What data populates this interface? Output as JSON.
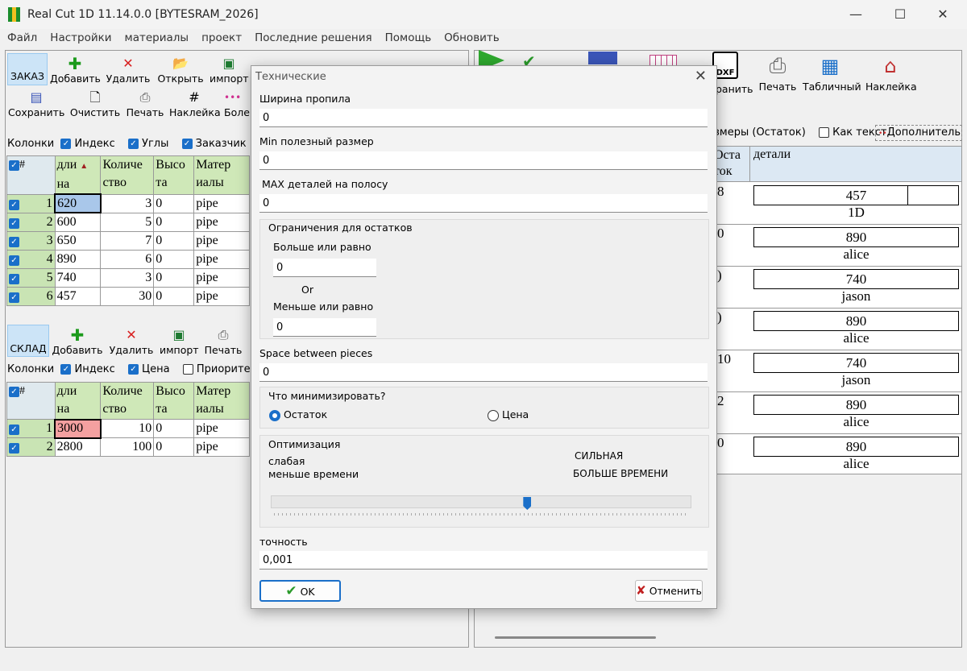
{
  "window": {
    "title": "Real Cut 1D 11.14.0.0 [BYTESRAM_2026]",
    "minimize": "—",
    "maximize": "☐",
    "close": "✕"
  },
  "menu": [
    "Файл",
    "Настройки",
    "материалы",
    "проект",
    "Последние решения",
    "Помощь",
    "Обновить"
  ],
  "order_toolbar": {
    "tab": "ЗАКАЗ",
    "add": "Добавить",
    "delete": "Удалить",
    "open": "Открыть",
    "import": "импорт",
    "save": "Сохранить",
    "clear": "Очистить",
    "print": "Печать",
    "label": "Наклейка",
    "more": "Боле"
  },
  "order_columns": {
    "label": "Колонки",
    "index": "Индекс",
    "angles": "Углы",
    "customer": "Заказчик"
  },
  "order_table": {
    "headers": [
      [
        "#",
        ""
      ],
      [
        "дли",
        "на"
      ],
      [
        "Количе",
        "ство"
      ],
      [
        "Высо",
        "та"
      ],
      [
        "Матер",
        "иалы"
      ]
    ],
    "rows": [
      {
        "n": "1",
        "length": "620",
        "qty": "3",
        "height": "0",
        "mat": "pipe"
      },
      {
        "n": "2",
        "length": "600",
        "qty": "5",
        "height": "0",
        "mat": "pipe"
      },
      {
        "n": "3",
        "length": "650",
        "qty": "7",
        "height": "0",
        "mat": "pipe"
      },
      {
        "n": "4",
        "length": "890",
        "qty": "6",
        "height": "0",
        "mat": "pipe"
      },
      {
        "n": "5",
        "length": "740",
        "qty": "3",
        "height": "0",
        "mat": "pipe"
      },
      {
        "n": "6",
        "length": "457",
        "qty": "30",
        "height": "0",
        "mat": "pipe"
      }
    ]
  },
  "stock_toolbar": {
    "tab": "СКЛАД",
    "add": "Добавить",
    "delete": "Удалить",
    "import": "импорт",
    "print": "Печать"
  },
  "stock_columns": {
    "label": "Колонки",
    "index": "Индекс",
    "price": "Цена",
    "priority": "Приоритет"
  },
  "stock_table": {
    "headers": [
      [
        "#",
        ""
      ],
      [
        "дли",
        "на"
      ],
      [
        "Количе",
        "ство"
      ],
      [
        "Высо",
        "та"
      ],
      [
        "Матер",
        "иалы"
      ]
    ],
    "rows": [
      {
        "n": "1",
        "length": "3000",
        "qty": "10",
        "height": "0",
        "mat": "pipe"
      },
      {
        "n": "2",
        "length": "2800",
        "qty": "100",
        "height": "0",
        "mat": "pipe"
      }
    ]
  },
  "right_toolbar": {
    "save": "ранить",
    "print": "Печать",
    "table": "Табличный",
    "label": "Наклейка",
    "dxf": "DXF"
  },
  "right_options": {
    "sizes": "змеры (Остаток)",
    "as_text": "Как текст",
    "more": "Дополнительны"
  },
  "result_table": {
    "headers": {
      "remainder_1": "Оста",
      "remainder_2": "ток",
      "details": "детали"
    },
    "rows": [
      {
        "rem": "8",
        "piece": "457",
        "name": "1D"
      },
      {
        "rem": "0",
        "piece": "890",
        "name": "alice"
      },
      {
        "rem": ")",
        "piece": "740",
        "name": "jason"
      },
      {
        "rem": ")",
        "piece": "890",
        "name": "alice"
      },
      {
        "rem": "10",
        "piece": "740",
        "name": "jason"
      },
      {
        "rem": "2",
        "piece": "890",
        "name": "alice"
      },
      {
        "rem": "0",
        "piece": "890",
        "name": "alice"
      }
    ]
  },
  "dialog": {
    "title": "Технические",
    "kerf_label": "Ширина пропила",
    "kerf_value": "0",
    "min_label": "Min полезный размер",
    "min_value": "0",
    "max_label": "MAX деталей на полосу",
    "max_value": "0",
    "limits_title": "Ограничения  для остатков",
    "ge_label": "Больше или равно",
    "ge_value": "0",
    "or_label": "Or",
    "le_label": "Меньше или равно",
    "le_value": "0",
    "space_label": "Space between pieces",
    "space_value": "0",
    "minimize_title": "Что минимизировать?",
    "opt_remainder": "Остаток",
    "opt_price": "Цена",
    "optimization_title": "Оптимизация",
    "weak": "слабая",
    "less_time": "меньше времени",
    "strong": "СИЛЬНАЯ",
    "more_time": "БОЛЬШЕ ВРЕМЕНИ",
    "slider_level": 0.61,
    "precision_label": "точность",
    "precision_value": "0,001",
    "ok": "OK",
    "cancel": "Отменить"
  },
  "colors": {
    "selected_cell": "#a9c7ea",
    "stock_highlight": "#f4a0a0",
    "header_green": "#cfe8b8",
    "accent": "#1a6fc9"
  }
}
